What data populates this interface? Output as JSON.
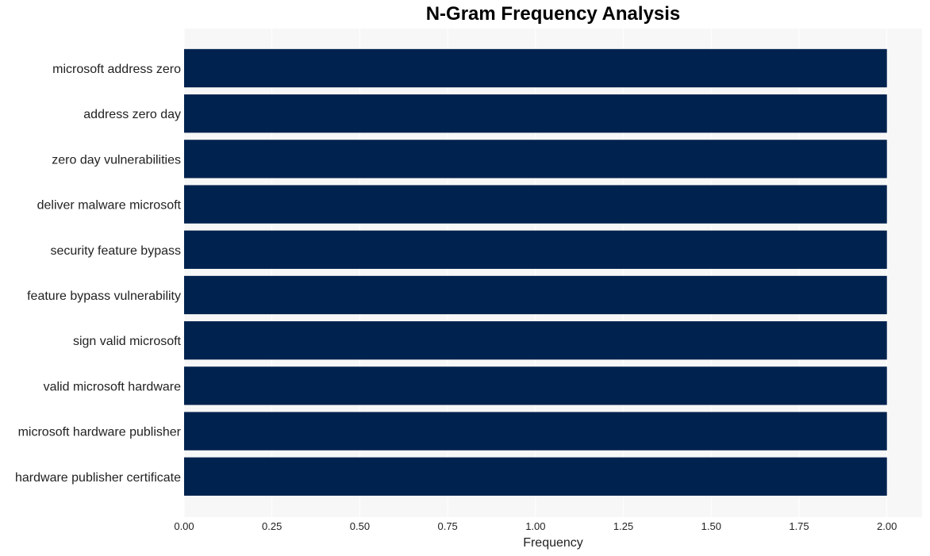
{
  "chart_data": {
    "type": "bar",
    "orientation": "horizontal",
    "title": "N-Gram Frequency Analysis",
    "xlabel": "Frequency",
    "ylabel": "",
    "categories": [
      "microsoft address zero",
      "address zero day",
      "zero day vulnerabilities",
      "deliver malware microsoft",
      "security feature bypass",
      "feature bypass vulnerability",
      "sign valid microsoft",
      "valid microsoft hardware",
      "microsoft hardware publisher",
      "hardware publisher certificate"
    ],
    "values": [
      2,
      2,
      2,
      2,
      2,
      2,
      2,
      2,
      2,
      2
    ],
    "xlim": [
      0,
      2.1
    ],
    "xticks": [
      "0.00",
      "0.25",
      "0.50",
      "0.75",
      "1.00",
      "1.25",
      "1.50",
      "1.75",
      "2.00"
    ],
    "grid": true,
    "legend": "none",
    "colors": {
      "bar": "#00224e",
      "plot_background": "#f7f7f7",
      "grid": "#ffffff"
    }
  }
}
